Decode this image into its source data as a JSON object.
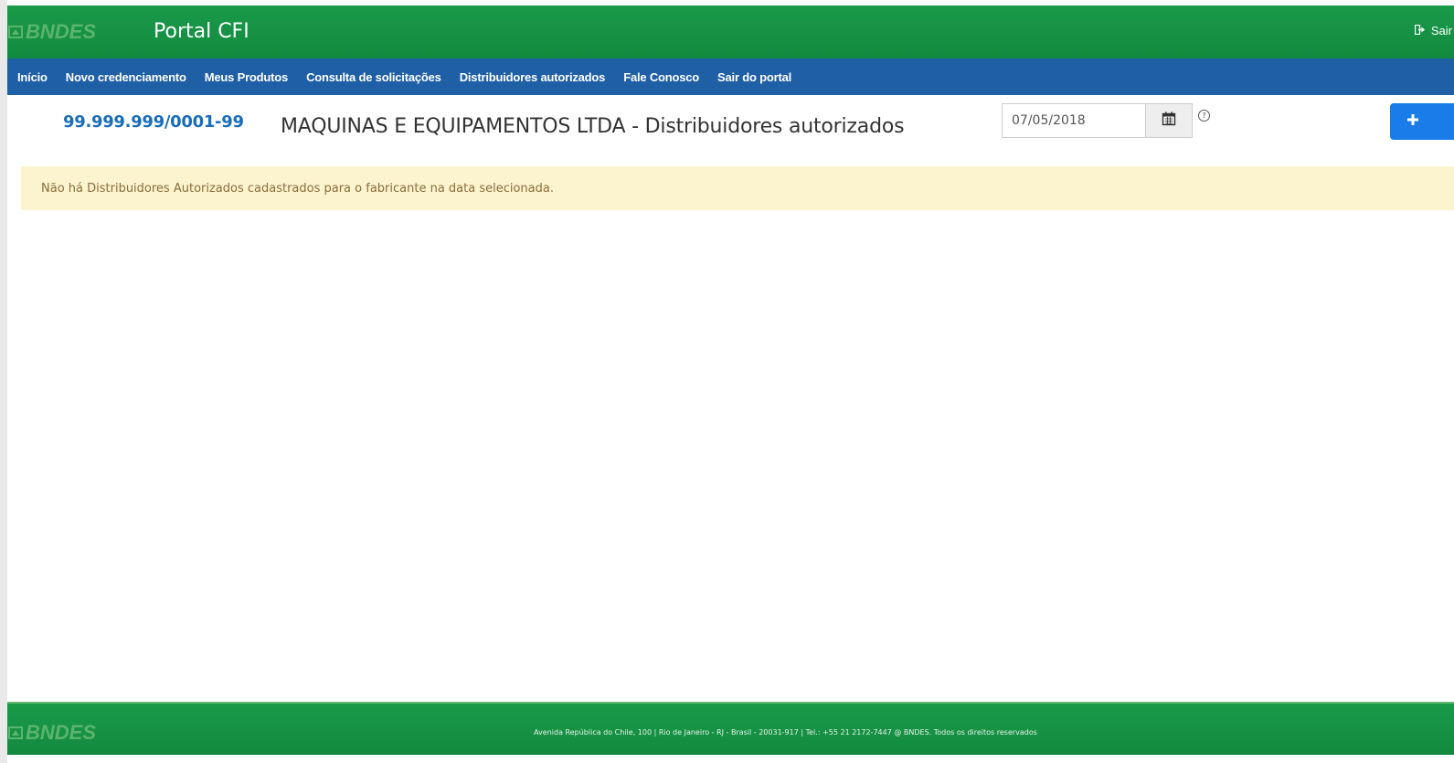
{
  "header": {
    "brand": "BNDES",
    "title": "Portal CFI",
    "logout_label": "Sair"
  },
  "nav": {
    "items": [
      {
        "label": "Início"
      },
      {
        "label": "Novo credenciamento"
      },
      {
        "label": "Meus Produtos"
      },
      {
        "label": "Consulta de solicitações"
      },
      {
        "label": "Distribuidores autorizados"
      },
      {
        "label": "Fale Conosco"
      },
      {
        "label": "Sair do portal"
      }
    ]
  },
  "main": {
    "cnpj": "99.999.999/0001-99",
    "heading": "MAQUINAS E EQUIPAMENTOS LTDA - Distribuidores autorizados",
    "date_value": "07/05/2018",
    "help_symbol": "?",
    "alert_text": "Não há Distribuidores Autorizados cadastrados para o fabricante na data selecionada."
  },
  "footer": {
    "brand": "BNDES",
    "text": "Avenida República do Chile, 100 | Rio de Janeiro - RJ - Brasil - 20031-917 | Tel.: +55 21 2172-7447 @ BNDES. Todos os direitos reservados"
  },
  "colors": {
    "header_green": "#1a9a4a",
    "nav_blue": "#1f5fa6",
    "cnpj_blue": "#1a6db8",
    "add_button_blue": "#1a7ce8",
    "alert_background": "#fcf3cf",
    "alert_text": "#8a6d3b"
  },
  "icons": {
    "logout": "sign-out-icon",
    "calendar": "calendar-icon",
    "help": "question-circle-icon",
    "add": "plus-icon",
    "logo": "bndes-logo-icon"
  }
}
